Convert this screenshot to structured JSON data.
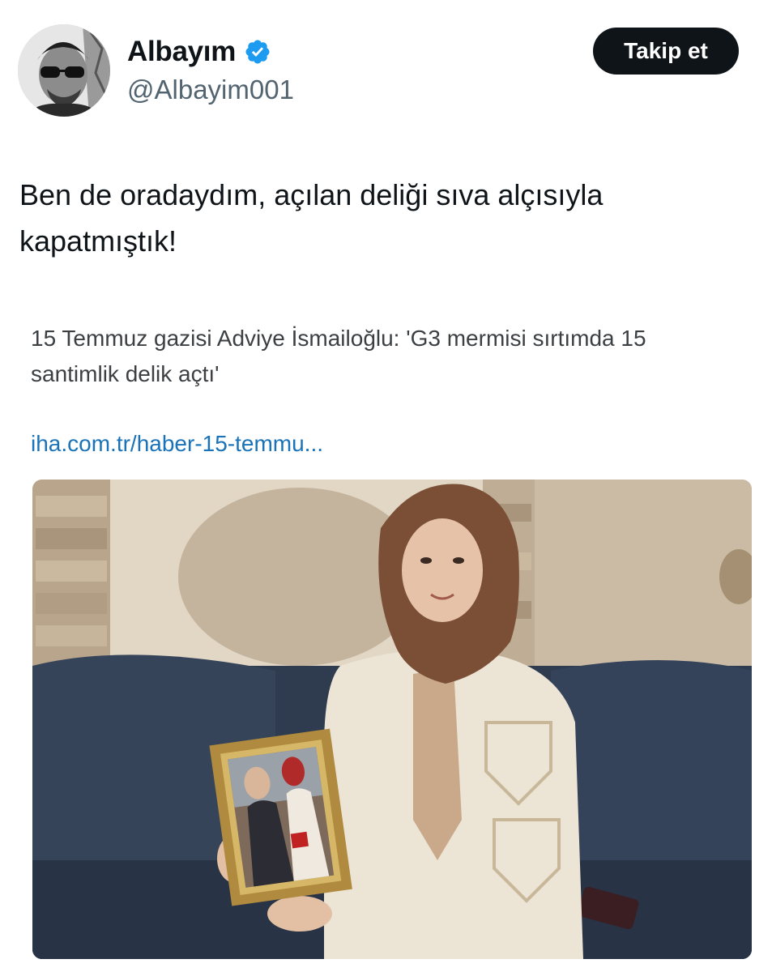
{
  "author": {
    "display_name": "Albayım",
    "handle": "@Albayim001",
    "verified_icon": "verified-badge-icon",
    "verified_color": "#1d9bf0"
  },
  "actions": {
    "follow_label": "Takip et"
  },
  "tweet": {
    "text": "Ben de oradaydım, açılan deliği sıva alçısıyla kapatmıştık!"
  },
  "news_card": {
    "headline": "15 Temmuz gazisi Adviye İsmailoğlu: 'G3 mermisi sırtımda 15 santimlik delik açtı'",
    "link_text": "iha.com.tr/haber-15-temmu...",
    "link_color": "#1a73b8"
  },
  "colors": {
    "button_bg": "#0f1419",
    "text_primary": "#0f1419",
    "text_secondary": "#536471"
  }
}
